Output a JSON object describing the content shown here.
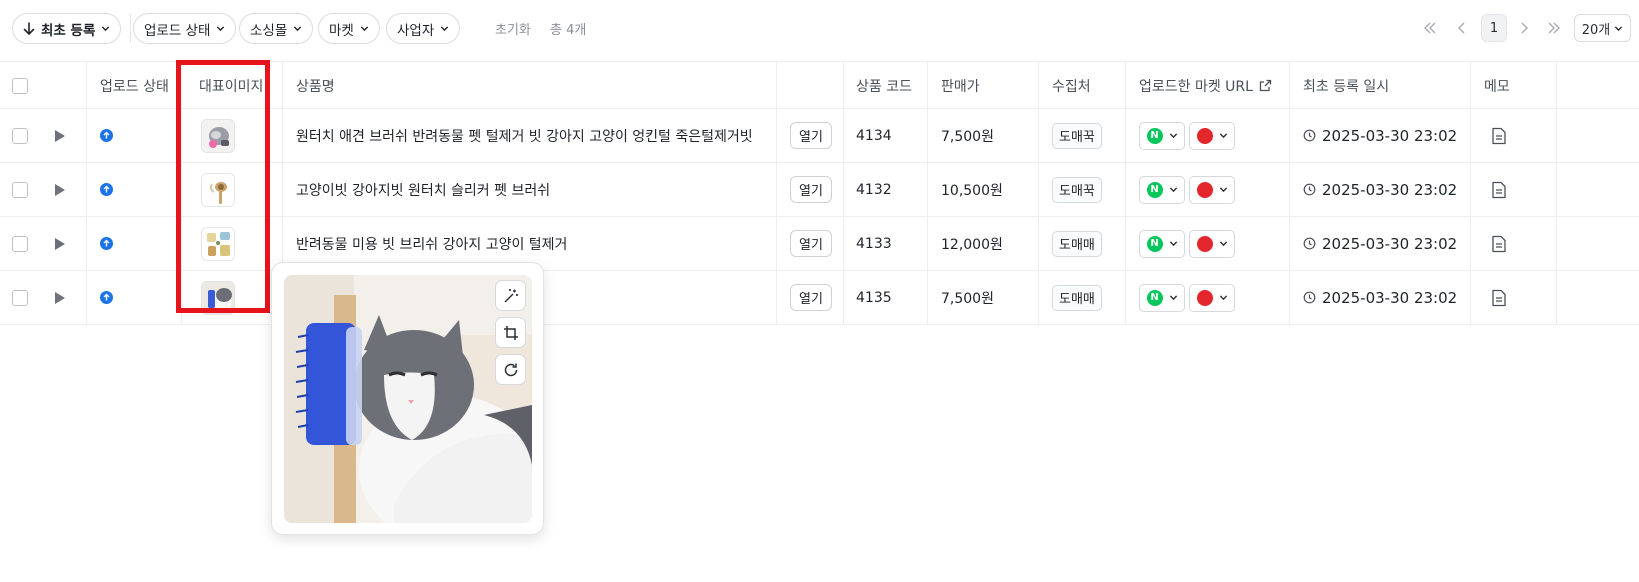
{
  "toolbar": {
    "sort_label": "최초 등록",
    "filters": [
      "업로드 상태",
      "소싱몰",
      "마켓",
      "사업자"
    ],
    "reset_label": "초기화",
    "count_label": "총 4개",
    "current_page": "1",
    "per_page": "20개"
  },
  "columns": {
    "upload_status": "업로드 상태",
    "main_image": "대표이미지",
    "product_name": "상품명",
    "product_code": "상품 코드",
    "price": "판매가",
    "source": "수집처",
    "market_url": "업로드한 마켓 URL",
    "registered_at": "최초 등록 일시",
    "memo": "메모"
  },
  "rows": [
    {
      "name": "원터치 애견 브러쉬 반려동물 펫 털제거 빗 강아지 고양이 엉킨털 죽은털제거빗",
      "open_label": "열기",
      "code": "4134",
      "price": "7,500원",
      "source": "도매꾹",
      "date": "2025-03-30 23:02"
    },
    {
      "name": "고양이빗 강아지빗 원터치 슬리커 펫 브러쉬",
      "open_label": "열기",
      "code": "4132",
      "price": "10,500원",
      "source": "도매꾹",
      "date": "2025-03-30 23:02"
    },
    {
      "name": "반려동물 미용 빗 브리쉬 강아지 고양이 털제거",
      "open_label": "열기",
      "code": "4133",
      "price": "12,000원",
      "source": "도매매",
      "date": "2025-03-30 23:02"
    },
    {
      "name": "",
      "open_label": "열기",
      "code": "4135",
      "price": "7,500원",
      "source": "도매매",
      "date": "2025-03-30 23:02"
    }
  ],
  "market_badges": {
    "naver": "N"
  },
  "icons": {
    "sort": "arrow-down-icon",
    "chevron": "chevron-down-icon",
    "first_page": "double-chevron-left-icon",
    "prev_page": "chevron-left-icon",
    "next_page": "chevron-right-icon",
    "last_page": "double-chevron-right-icon",
    "external": "external-link-icon",
    "clock": "clock-icon",
    "memo": "document-icon",
    "magic": "magic-wand-icon",
    "crop": "crop-icon",
    "rotate": "rotate-icon"
  },
  "colors": {
    "highlight": "#e8141b",
    "upload_status": "#1a73e8",
    "naver": "#03c75a",
    "coupang": "#e3262c"
  }
}
